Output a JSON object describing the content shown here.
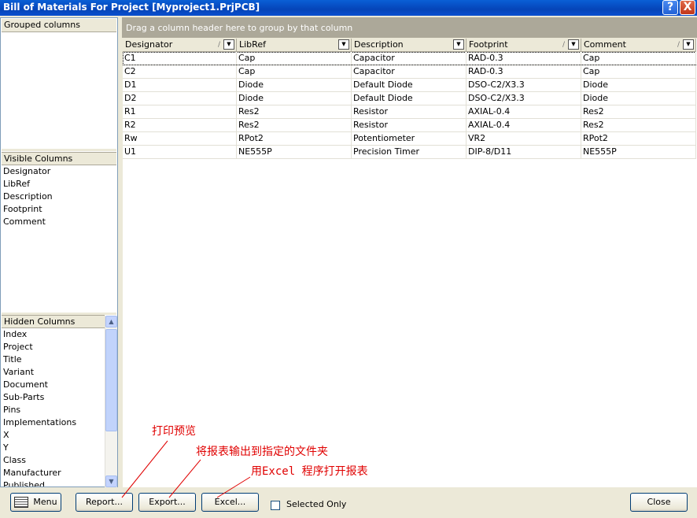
{
  "window": {
    "title": "Bill of Materials For Project [Myproject1.PrjPCB]"
  },
  "titlebar_buttons": {
    "help": "?",
    "close": "X"
  },
  "left": {
    "grouped_header": "Grouped columns",
    "visible_header": "Visible Columns",
    "visible": [
      "Designator",
      "LibRef",
      "Description",
      "Footprint",
      "Comment"
    ],
    "hidden_header": "Hidden Columns",
    "hidden": [
      "Index",
      "Project",
      "Title",
      "Variant",
      "Document",
      "Sub-Parts",
      "Pins",
      "Implementations",
      "X",
      "Y",
      "Class",
      "Manufacturer",
      "Published"
    ]
  },
  "grid": {
    "group_hint": "Drag a column header here to group by that column",
    "columns": [
      "Designator",
      "LibRef",
      "Description",
      "Footprint",
      "Comment"
    ],
    "rows": [
      [
        "C1",
        "Cap",
        "Capacitor",
        "RAD-0.3",
        "Cap"
      ],
      [
        "C2",
        "Cap",
        "Capacitor",
        "RAD-0.3",
        "Cap"
      ],
      [
        "D1",
        "Diode",
        "Default Diode",
        "DSO-C2/X3.3",
        "Diode"
      ],
      [
        "D2",
        "Diode",
        "Default Diode",
        "DSO-C2/X3.3",
        "Diode"
      ],
      [
        "R1",
        "Res2",
        "Resistor",
        "AXIAL-0.4",
        "Res2"
      ],
      [
        "R2",
        "Res2",
        "Resistor",
        "AXIAL-0.4",
        "Res2"
      ],
      [
        "Rw",
        "RPot2",
        "Potentiometer",
        "VR2",
        "RPot2"
      ],
      [
        "U1",
        "NE555P",
        "Precision Timer",
        "DIP-8/D11",
        "NE555P"
      ]
    ]
  },
  "buttons": {
    "menu": "Menu",
    "report": "Report...",
    "export": "Export...",
    "excel": "Excel...",
    "selected_only": "Selected Only",
    "close": "Close"
  },
  "annotations": {
    "print_preview": "打印预览",
    "export_note": "将报表输出到指定的文件夹",
    "excel_note": "用Excel 程序打开报表"
  },
  "colors": {
    "annotation": "#e00000",
    "titlebar": "#0a5fd6"
  }
}
